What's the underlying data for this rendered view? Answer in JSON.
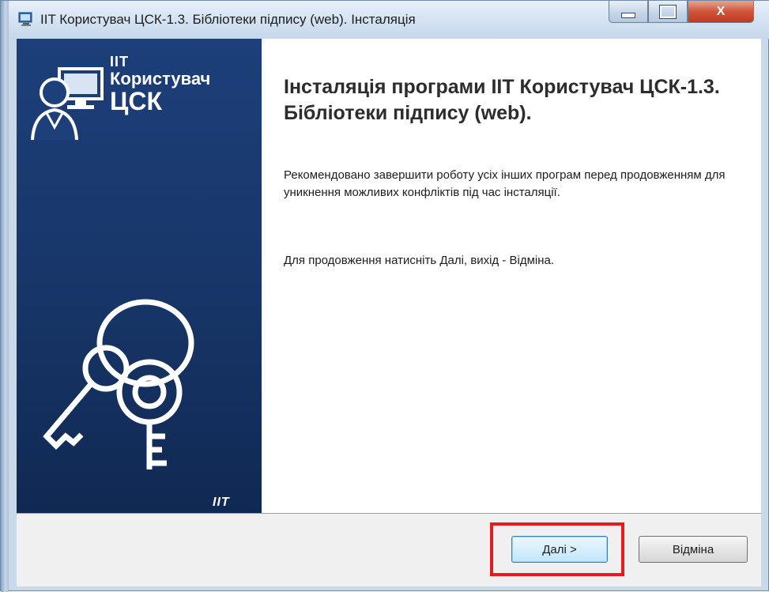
{
  "window": {
    "title": "IIT Користувач ЦСК-1.3. Бібліотеки підпису (web). Інсталяція",
    "close_label": "X"
  },
  "sidebar": {
    "logo_line1": "IIT",
    "logo_line2": "Користувач",
    "logo_line3": "ЦСК",
    "brand": "IIT"
  },
  "main": {
    "heading": "Інсталяція програми IIT Користувач ЦСК-1.3. Бібліотеки підпису (web).",
    "paragraph1": "Рекомендовано завершити роботу усіх інших програм перед продовженням для уникнення можливих конфліктів під час інсталяції.",
    "paragraph2": "Для продовження натисніть Далі, вихід - Відміна."
  },
  "buttons": {
    "next": "Далі >",
    "cancel": "Відміна"
  },
  "colors": {
    "sidebar_bg": "#1d3f7a",
    "highlight": "#e41c1c",
    "close_button": "#c0391f"
  },
  "icons": {
    "title_icon": "installer-icon",
    "user_icon": "user-computer-icon",
    "keys_icon": "keys-icon"
  }
}
